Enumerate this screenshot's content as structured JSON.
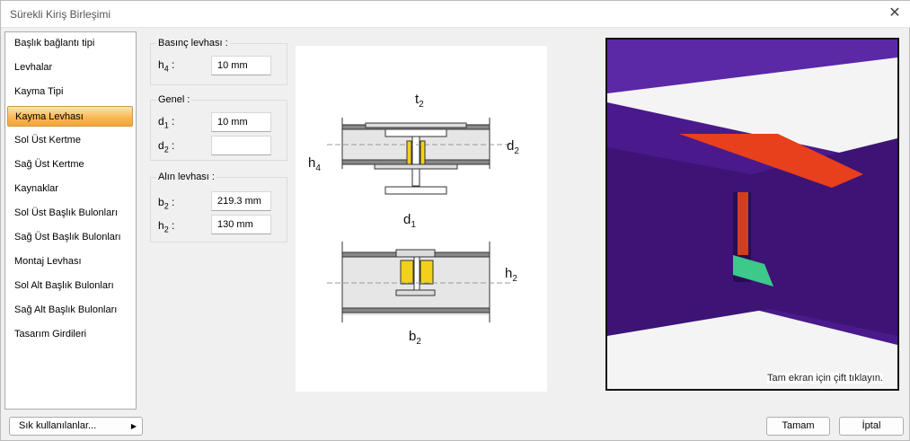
{
  "window": {
    "title": "Sürekli Kiriş Birleşimi",
    "close_icon": "close-icon"
  },
  "sidebar": {
    "selected": 3,
    "items": [
      {
        "label": "Başlık bağlantı tipi"
      },
      {
        "label": "Levhalar"
      },
      {
        "label": "Kayma Tipi"
      },
      {
        "label": "Kayma Levhası"
      },
      {
        "label": "Sol Üst Kertme"
      },
      {
        "label": "Sağ Üst Kertme"
      },
      {
        "label": "Kaynaklar"
      },
      {
        "label": "Sol Üst Başlık Bulonları"
      },
      {
        "label": "Sağ Üst Başlık Bulonları"
      },
      {
        "label": "Montaj Levhası"
      },
      {
        "label": "Sol Alt Başlık Bulonları"
      },
      {
        "label": "Sağ Alt Başlık Bulonları"
      },
      {
        "label": "Tasarım Girdileri"
      }
    ]
  },
  "groups": {
    "basinc": {
      "title": "Basınç levhası :",
      "h4": {
        "sym": "h",
        "sub": "4",
        "value": "10 mm"
      }
    },
    "genel": {
      "title": "Genel :",
      "d1": {
        "sym": "d",
        "sub": "1",
        "value": "10 mm"
      },
      "d2": {
        "sym": "d",
        "sub": "2",
        "value": ""
      }
    },
    "alin": {
      "title": "Alın levhası :",
      "b2": {
        "sym": "b",
        "sub": "2",
        "value": "219.3 mm"
      },
      "h2": {
        "sym": "h",
        "sub": "2",
        "value": "130 mm"
      }
    }
  },
  "diagram": {
    "labels": {
      "t2": "t",
      "t2s": "2",
      "d2": "d",
      "d2s": "2",
      "h4": "h",
      "h4s": "4",
      "d1": "d",
      "d1s": "1",
      "h2": "h",
      "h2s": "2",
      "b2": "b",
      "b2s": "2"
    }
  },
  "view3d": {
    "hint": "Tam ekran için çift tıklayın.",
    "colors": {
      "beam": "#4a1a8c",
      "plate": "#e8401c",
      "angle": "#3cc98a"
    }
  },
  "footer": {
    "favorites": "Sık kullanılanlar...",
    "ok": "Tamam",
    "cancel": "İptal"
  }
}
